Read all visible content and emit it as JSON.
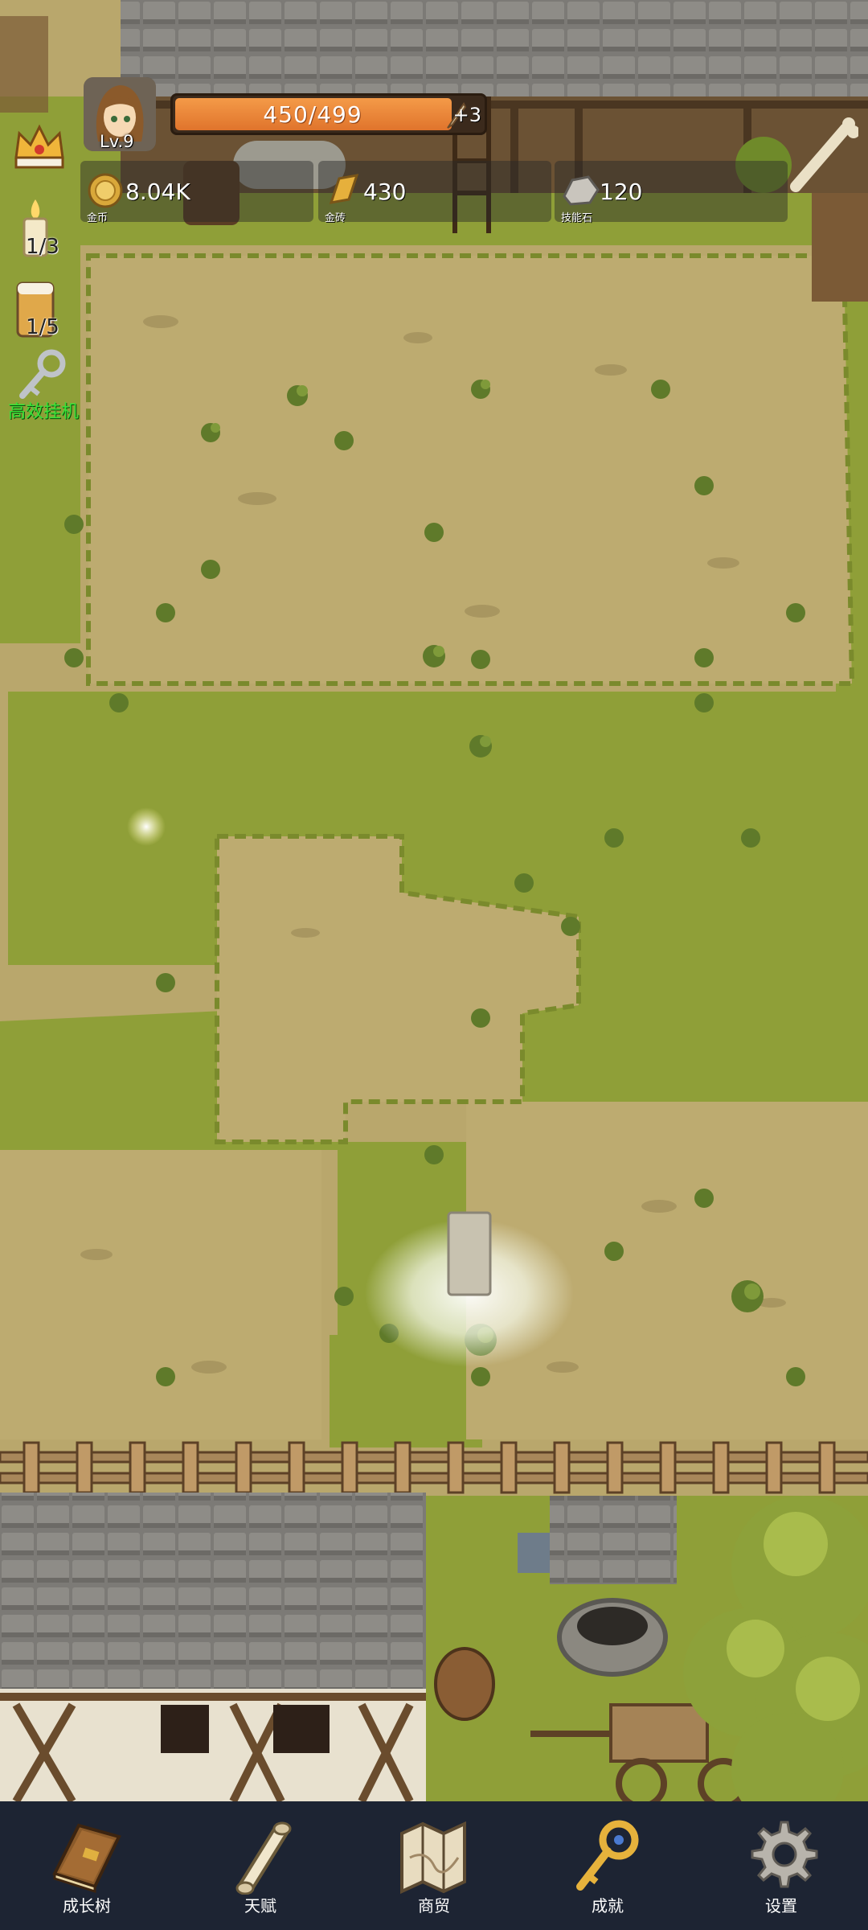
{
  "player": {
    "level": "Lv.9"
  },
  "hp": {
    "current_max": "450/499",
    "bonus": "+3",
    "fill_fraction": 0.9
  },
  "resources": [
    {
      "value": "8.04K",
      "caption": "金币",
      "icon": "gold-coin-icon"
    },
    {
      "value": "430",
      "caption": "金砖",
      "icon": "gold-bar-icon"
    },
    {
      "value": "120",
      "caption": "技能石",
      "icon": "skill-stone-icon"
    }
  ],
  "side": {
    "candle_count": "1/3",
    "drink_count": "1/5",
    "afk_label": "高效挂机"
  },
  "nav": [
    {
      "label": "成长树",
      "icon": "book-icon"
    },
    {
      "label": "天赋",
      "icon": "scroll-icon"
    },
    {
      "label": "商贸",
      "icon": "map-icon"
    },
    {
      "label": "成就",
      "icon": "key-icon"
    },
    {
      "label": "设置",
      "icon": "gear-icon"
    }
  ],
  "colors": {
    "dirt": "#b9a76c",
    "grass": "#8f9f38",
    "hp_fill": "#e77f33",
    "nav_bg": "#1d2433"
  }
}
